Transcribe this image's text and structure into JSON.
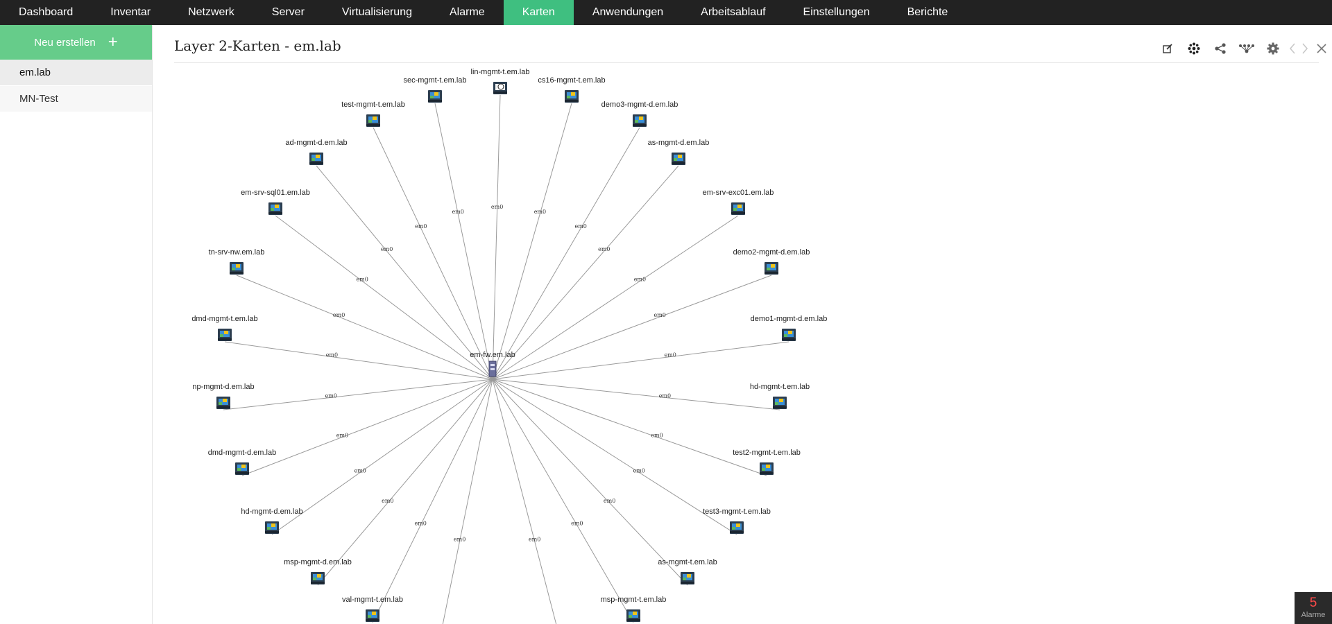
{
  "colors": {
    "nav_bg": "#222222",
    "nav_active": "#3fbf80",
    "new_button": "#66cc8a",
    "edge": "#9a9a9a",
    "alarm_text": "#ff4a4a"
  },
  "nav": {
    "items": [
      "Dashboard",
      "Inventar",
      "Netzwerk",
      "Server",
      "Virtualisierung",
      "Alarme",
      "Karten",
      "Anwendungen",
      "Arbeitsablauf",
      "Einstellungen",
      "Berichte"
    ],
    "active": "Karten"
  },
  "sidebar": {
    "new_button_label": "Neu erstellen",
    "new_button_icon": "plus-icon",
    "items": [
      {
        "label": "em.lab",
        "selected": true
      },
      {
        "label": "MN-Test",
        "selected": false
      }
    ]
  },
  "page": {
    "title": "Layer 2-Karten - em.lab"
  },
  "toolbar": {
    "icons": [
      "edit-icon",
      "layout-icon",
      "share-icon",
      "topology-icon",
      "settings-icon",
      "chevron-left-icon",
      "chevron-right-icon",
      "close-icon"
    ]
  },
  "map": {
    "center": {
      "label": "em-fw.em.lab",
      "icon": "firewall-icon"
    },
    "interface_label": "em0",
    "nodes": [
      "sec-mgmt-t.em.lab",
      "lin-mgmt-t.em.lab",
      "cs16-mgmt-t.em.lab",
      "test-mgmt-t.em.lab",
      "demo3-mgmt-d.em.lab",
      "ad-mgmt-d.em.lab",
      "as-mgmt-d.em.lab",
      "em-srv-sql01.em.lab",
      "em-srv-exc01.em.lab",
      "tn-srv-nw.em.lab",
      "demo2-mgmt-d.em.lab",
      "dmd-mgmt-t.em.lab",
      "demo1-mgmt-d.em.lab",
      "np-mgmt-d.em.lab",
      "hd-mgmt-t.em.lab",
      "dmd-mgmt-d.em.lab",
      "test2-mgmt-t.em.lab",
      "hd-mgmt-d.em.lab",
      "test3-mgmt-t.em.lab",
      "msp-mgmt-d.em.lab",
      "as-mgmt-t.em.lab",
      "val-mgmt-t.em.lab",
      "msp-mgmt-t.em.lab"
    ]
  },
  "alarm": {
    "count": "5",
    "label": "Alarme"
  }
}
